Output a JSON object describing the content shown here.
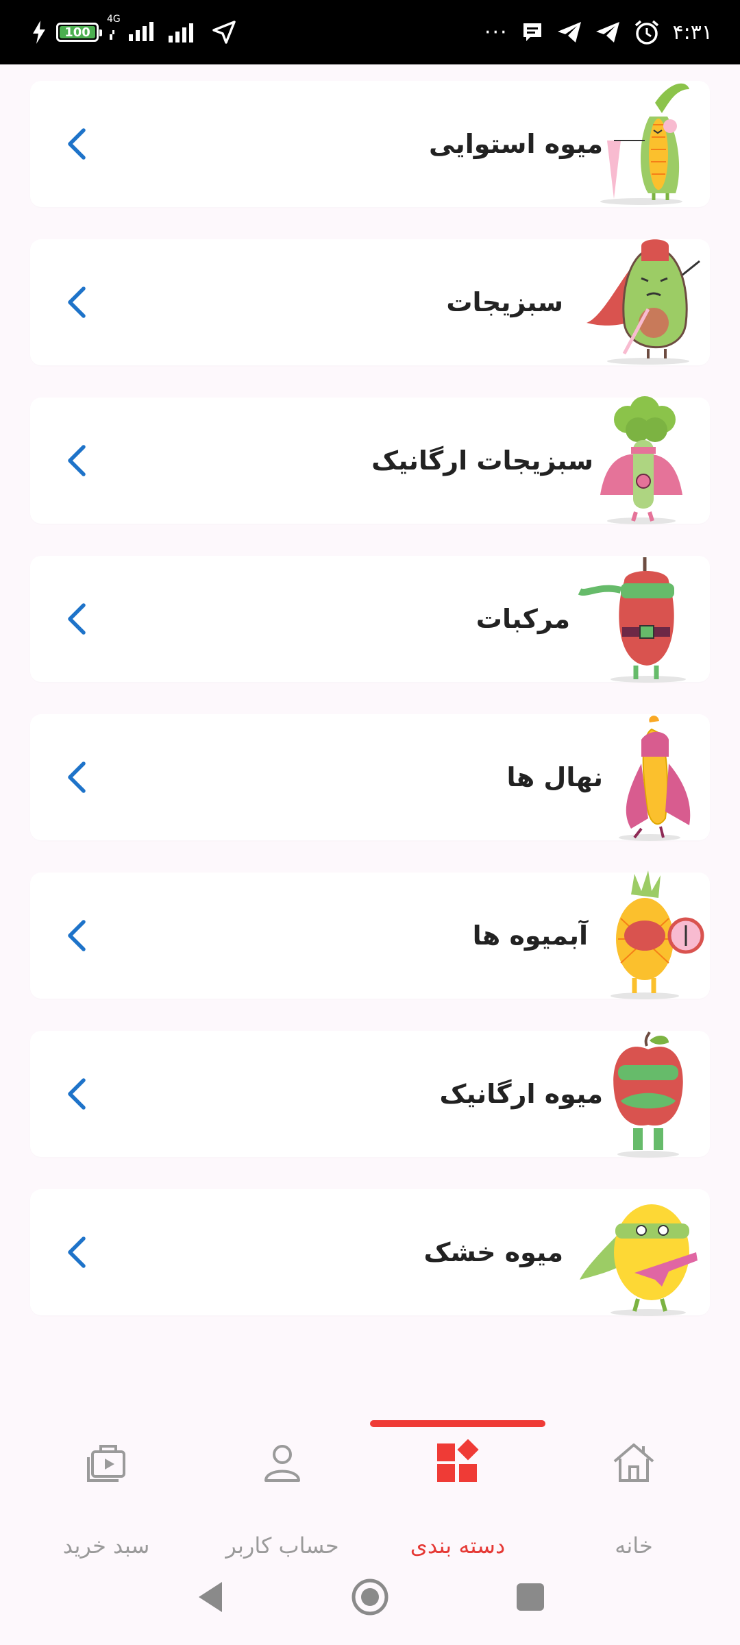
{
  "status_bar": {
    "battery": "100",
    "network": "4G",
    "time": "۴:۳۱",
    "more": "···"
  },
  "categories": [
    {
      "label": "میوه استوایی",
      "mascot": "corn-hero-icon"
    },
    {
      "label": "سبزیجات",
      "mascot": "avocado-hero-icon"
    },
    {
      "label": "سبزیجات ارگانیک",
      "mascot": "broccoli-hero-icon"
    },
    {
      "label": "مرکبات",
      "mascot": "pepper-hero-icon"
    },
    {
      "label": "نهال ها",
      "mascot": "banana-hero-icon"
    },
    {
      "label": "آبمیوه ها",
      "mascot": "pineapple-hero-icon"
    },
    {
      "label": "میوه ارگانیک",
      "mascot": "apple-hero-icon"
    },
    {
      "label": "میوه خشک",
      "mascot": "lemon-hero-icon"
    }
  ],
  "bottom_nav": {
    "items": [
      {
        "label": "سبد خرید",
        "icon": "cart-icon"
      },
      {
        "label": "حساب کاربر",
        "icon": "user-icon"
      },
      {
        "label": "دسته بندی",
        "icon": "category-icon",
        "active": true
      },
      {
        "label": "خانه",
        "icon": "home-icon"
      }
    ],
    "active_color": "#e53935",
    "inactive_color": "#9a9a9a"
  },
  "colors": {
    "chevron": "#1e73c9",
    "background": "#fdf8fc"
  }
}
